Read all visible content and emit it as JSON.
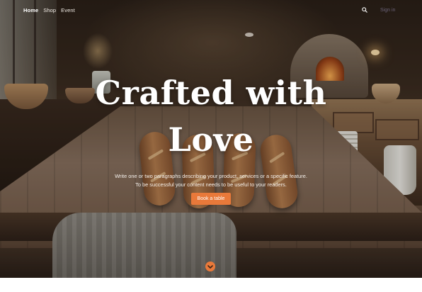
{
  "nav": {
    "links": [
      {
        "label": "Home",
        "active": true
      },
      {
        "label": "Shop",
        "active": false
      },
      {
        "label": "Event",
        "active": false
      }
    ],
    "search_icon": "search-icon",
    "signin_label": "Sign in"
  },
  "hero": {
    "title_line1": "Crafted with",
    "title_line2": "Love",
    "body_line1": "Write one or two paragraphs describing your product, services or a specific feature.",
    "body_line2": "To be successful your content needs to be useful to your readers.",
    "cta_label": "Book a table",
    "scroll_icon": "chevron-down-icon"
  },
  "colors": {
    "accent": "#e9793a",
    "text_light": "#ffffff"
  }
}
